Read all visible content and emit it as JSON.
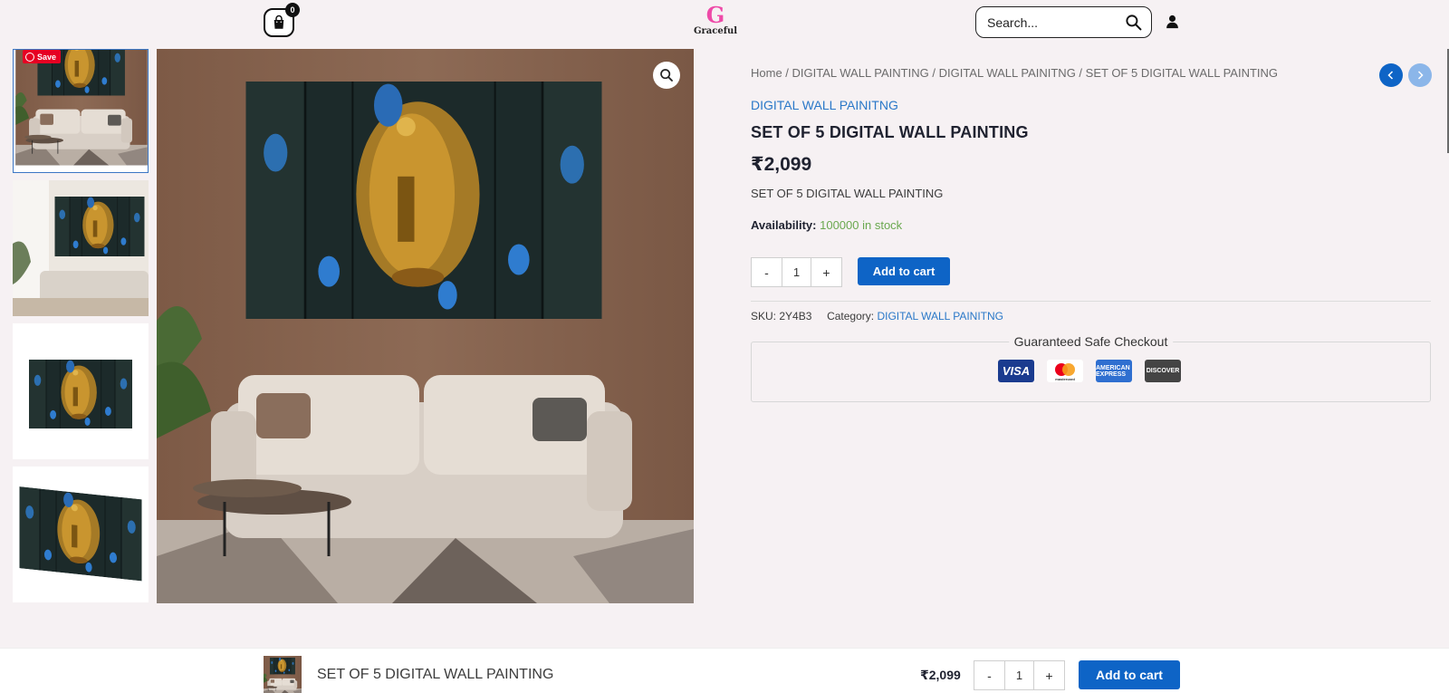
{
  "header": {
    "cart_count": "0",
    "logo_letter": "G",
    "logo_text": "Graceful",
    "search_placeholder": "Search..."
  },
  "gallery": {
    "pin_label": "Save"
  },
  "breadcrumb": [
    "Home",
    "DIGITAL WALL PAINTING",
    "DIGITAL WALL PAINITNG",
    "SET OF 5 DIGITAL WALL PAINTING"
  ],
  "product": {
    "category": "DIGITAL WALL PAINITNG",
    "title": "SET OF 5 DIGITAL WALL PAINTING",
    "price": "₹2,099",
    "short_description": "SET OF 5 DIGITAL WALL PAINTING",
    "availability_label": "Availability:",
    "availability_value": "100000 in stock",
    "quantity": "1",
    "minus": "-",
    "plus": "+",
    "add_to_cart": "Add to cart",
    "sku_label": "SKU:",
    "sku": "2Y4B3",
    "category_label": "Category:"
  },
  "checkout": {
    "title": "Guaranteed Safe Checkout",
    "cards": [
      "VISA",
      "mastercard",
      "AMERICAN EXPRESS",
      "DISCOVER"
    ]
  },
  "sticky": {
    "title": "SET OF 5 DIGITAL WALL PAINTING",
    "price": "₹2,099",
    "quantity": "1",
    "minus": "-",
    "plus": "+",
    "add_to_cart": "Add to cart"
  },
  "colors": {
    "accent": "#0e64c6",
    "link": "#2a78c8",
    "stock": "#6aa84f",
    "background": "#f6f1f3"
  }
}
